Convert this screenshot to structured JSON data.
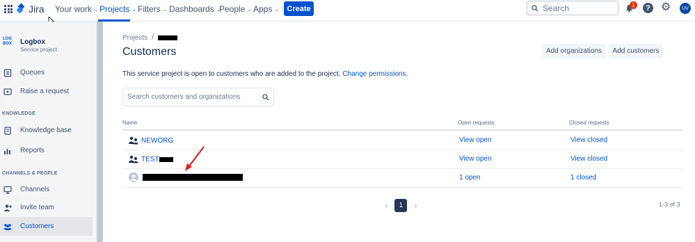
{
  "topnav": {
    "app_name": "Jira",
    "items": [
      "Your work",
      "Projects",
      "Filters",
      "Dashboards",
      "People",
      "Apps"
    ],
    "create_label": "Create",
    "search_placeholder": "Search",
    "notification_count": "1",
    "help_glyph": "?",
    "avatar_initials": "UV"
  },
  "sidebar": {
    "project_logo_text": "LOG BOX",
    "project_name": "Logbox",
    "project_type": "Service project",
    "items_top": [
      {
        "label": "Queues",
        "icon": "queues-icon"
      },
      {
        "label": "Raise a request",
        "icon": "raise-request-icon"
      }
    ],
    "heading_knowledge": "KNOWLEDGE",
    "items_knowledge": [
      {
        "label": "Knowledge base",
        "icon": "knowledge-base-icon"
      },
      {
        "label": "Reports",
        "icon": "reports-icon"
      }
    ],
    "heading_channels": "CHANNELS & PEOPLE",
    "items_channels": [
      {
        "label": "Channels",
        "icon": "channels-icon"
      },
      {
        "label": "Invite team",
        "icon": "invite-team-icon"
      },
      {
        "label": "Customers",
        "icon": "customers-icon"
      }
    ]
  },
  "main": {
    "breadcrumb_root": "Projects",
    "breadcrumb_sep": "/",
    "title": "Customers",
    "add_org_label": "Add organizations",
    "add_customers_label": "Add customers",
    "description": "This service project is open to customers who are added to the project.",
    "change_permissions_label": "Change permissions.",
    "search_placeholder": "Search customers and organizations",
    "columns": [
      "Name",
      "Open requests",
      "Closed requests"
    ],
    "rows": [
      {
        "name": "NEWORG",
        "open": "View open",
        "closed": "View closed"
      },
      {
        "name": "TEST",
        "open": "View open",
        "closed": "View closed"
      },
      {
        "name": "",
        "open": "1 open",
        "closed": "1 closed"
      }
    ],
    "pagination": {
      "current": "1",
      "prev": "‹",
      "next": "›"
    },
    "count_text": "1-3 of 3"
  },
  "colors": {
    "brand": "#0052cc",
    "sidebar_bg": "#f4f5f7",
    "annotation_arrow": "#e01e1e",
    "badge": "#de350b"
  }
}
